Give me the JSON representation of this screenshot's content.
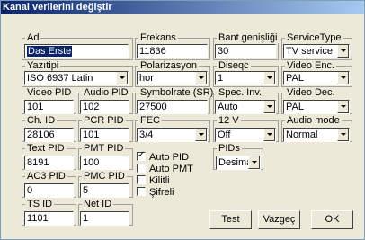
{
  "window": {
    "title": "Kanal verilerini değiştir"
  },
  "fields": {
    "ad": {
      "label": "Ad",
      "value": "Das Erste"
    },
    "frekans": {
      "label": "Frekans",
      "value": "11836"
    },
    "bant": {
      "label": "Bant genişliği",
      "value": "30"
    },
    "servicetype": {
      "label": "ServiceType",
      "value": "TV service"
    },
    "yazitipi": {
      "label": "Yazıtipi",
      "value": "ISO 6937 Latin"
    },
    "polarizasyon": {
      "label": "Polarizasyon",
      "value": "hor"
    },
    "diseqc": {
      "label": "Diseqc",
      "value": "1"
    },
    "videoenc": {
      "label": "Video Enc.",
      "value": "PAL"
    },
    "videopid": {
      "label": "Video PID",
      "value": "101"
    },
    "audiopid": {
      "label": "Audio PID",
      "value": "102"
    },
    "symbolrate": {
      "label": "Symbolrate (SR)",
      "value": "27500"
    },
    "specinv": {
      "label": "Spec. Inv.",
      "value": "Auto"
    },
    "videodec": {
      "label": "Video Dec.",
      "value": "PAL"
    },
    "chid": {
      "label": "Ch. ID",
      "value": "28106"
    },
    "pcrpid": {
      "label": "PCR PID",
      "value": "101"
    },
    "fec": {
      "label": "FEC",
      "value": "3/4"
    },
    "v12": {
      "label": "12 V",
      "value": "Off"
    },
    "audiomode": {
      "label": "Audio mode",
      "value": "Normal"
    },
    "textpid": {
      "label": "Text PID",
      "value": "8191"
    },
    "pmtpid": {
      "label": "PMT PID",
      "value": "100"
    },
    "ac3pid": {
      "label": "AC3 PID",
      "value": "0"
    },
    "pmcpid": {
      "label": "PMC PID",
      "value": "5"
    },
    "tsid": {
      "label": "TS ID",
      "value": "1101"
    },
    "netid": {
      "label": "Net ID",
      "value": "1"
    },
    "pids": {
      "label": "PIDs",
      "value": "Desimal"
    }
  },
  "checks": {
    "autopid": {
      "label": "Auto PID",
      "checked": true
    },
    "autopmt": {
      "label": "Auto PMT",
      "checked": false
    },
    "kilitli": {
      "label": "Kilitli",
      "checked": false
    },
    "sifreli": {
      "label": "Şifreli",
      "checked": false
    }
  },
  "buttons": {
    "test": "Test",
    "vazgec": "Vazgeç",
    "ok": "OK"
  }
}
